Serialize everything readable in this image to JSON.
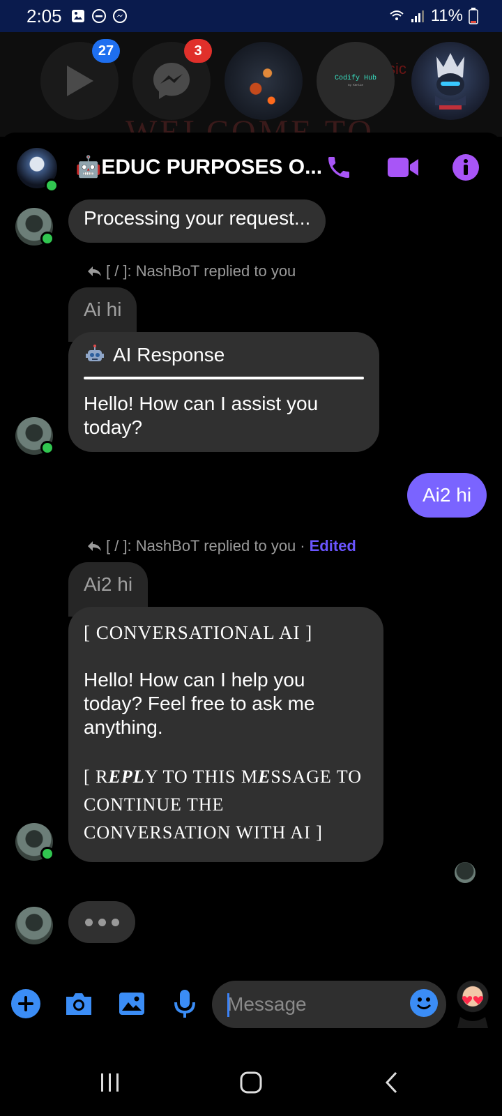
{
  "status_bar": {
    "time": "2:05",
    "battery": "11%"
  },
  "chat_heads": {
    "play_badge": "27",
    "messenger_badge": "3",
    "codify_title": "Codify Hub",
    "codify_sub": "by Kenlie",
    "background_text": "WELCOME TO",
    "ghost_text": "sic"
  },
  "header": {
    "title": "🤖EDUC PURPOSES O..."
  },
  "messages": {
    "processing": "Processing your request...",
    "reply_meta_1": "[ / ]: NashBoT replied to you",
    "quote_1": "Ai hi",
    "ai_response_title": "AI Response",
    "ai_response_body": "Hello! How can I assist you today?",
    "outgoing": "Ai2 hi",
    "reply_meta_2": "[ / ]: NashBoT replied to you",
    "reply_meta_sep": "·",
    "edited": "Edited",
    "quote_2": "Ai2 hi",
    "conv_header": "[ CONVERSATIONAL AI ]",
    "conv_body": "Hello! How can I help you today? Feel free to ask me anything.",
    "conv_footer_1": "[ R",
    "conv_footer_2": "EPL",
    "conv_footer_3": "Y TO THIS M",
    "conv_footer_4": "E",
    "conv_footer_5": "SSAGE TO CONTINUE THE CONVERSATION WITH AI ]"
  },
  "composer": {
    "placeholder": "Message"
  },
  "colors": {
    "accent_purple": "#a855f7",
    "outgoing_bubble": "#7a64ff",
    "online_green": "#31c650",
    "composer_blue": "#3b8df6"
  }
}
